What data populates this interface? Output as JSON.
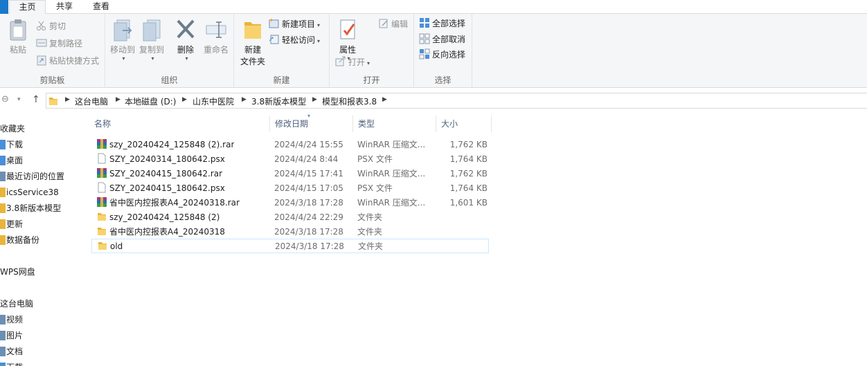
{
  "tabs": [
    {
      "label": "主页",
      "active": true
    },
    {
      "label": "共享",
      "active": false
    },
    {
      "label": "查看",
      "active": false
    }
  ],
  "ribbon": {
    "clipboard": {
      "label": "剪贴板",
      "paste": "粘贴",
      "cut": "剪切",
      "copy_path": "复制路径",
      "paste_shortcut": "粘贴快捷方式"
    },
    "organize": {
      "label": "组织",
      "move_to": "移动到",
      "copy_to": "复制到",
      "delete": "删除",
      "rename": "重命名"
    },
    "new": {
      "label": "新建",
      "new_folder": "新建\n文件夹",
      "new_folder_l1": "新建",
      "new_folder_l2": "文件夹",
      "new_item": "新建项目",
      "easy_access": "轻松访问"
    },
    "open": {
      "label": "打开",
      "properties": "属性",
      "open": "打开",
      "edit": "编辑"
    },
    "select": {
      "label": "选择",
      "select_all": "全部选择",
      "select_none": "全部取消",
      "invert": "反向选择"
    }
  },
  "breadcrumb": [
    "这台电脑",
    "本地磁盘 (D:)",
    "山东中医院",
    "3.8新版本模型",
    "模型和报表3.8"
  ],
  "nav": {
    "quick_access": "收藏夹",
    "items": [
      "下载",
      "桌面",
      "最近访问的位置",
      "icsService38",
      "3.8新版本模型",
      "更新",
      "数据备份"
    ],
    "wps": "WPS网盘",
    "this_pc": "这台电脑",
    "pc_items": [
      "视频",
      "图片",
      "文档",
      "下载"
    ]
  },
  "columns": {
    "name": "名称",
    "date": "修改日期",
    "type": "类型",
    "size": "大小"
  },
  "files": [
    {
      "name": "szy_20240424_125848 (2).rar",
      "date": "2024/4/24 15:55",
      "type": "WinRAR 压缩文...",
      "size": "1,762 KB",
      "icon": "rar"
    },
    {
      "name": "SZY_20240314_180642.psx",
      "date": "2024/4/24 8:44",
      "type": "PSX 文件",
      "size": "1,764 KB",
      "icon": "file"
    },
    {
      "name": "SZY_20240415_180642.rar",
      "date": "2024/4/15 17:41",
      "type": "WinRAR 压缩文...",
      "size": "1,762 KB",
      "icon": "rar"
    },
    {
      "name": "SZY_20240415_180642.psx",
      "date": "2024/4/15 17:05",
      "type": "PSX 文件",
      "size": "1,764 KB",
      "icon": "file"
    },
    {
      "name": "省中医内控报表A4_20240318.rar",
      "date": "2024/3/18 17:28",
      "type": "WinRAR 压缩文...",
      "size": "1,601 KB",
      "icon": "rar"
    },
    {
      "name": "szy_20240424_125848 (2)",
      "date": "2024/4/24 22:29",
      "type": "文件夹",
      "size": "",
      "icon": "folder"
    },
    {
      "name": "省中医内控报表A4_20240318",
      "date": "2024/3/18 17:28",
      "type": "文件夹",
      "size": "",
      "icon": "folder"
    },
    {
      "name": "old",
      "date": "2024/3/18 17:28",
      "type": "文件夹",
      "size": "",
      "icon": "folder"
    }
  ],
  "colors": {
    "accent": "#1979ca",
    "selection_border": "#cce8ff",
    "folder": "#f4c443"
  }
}
